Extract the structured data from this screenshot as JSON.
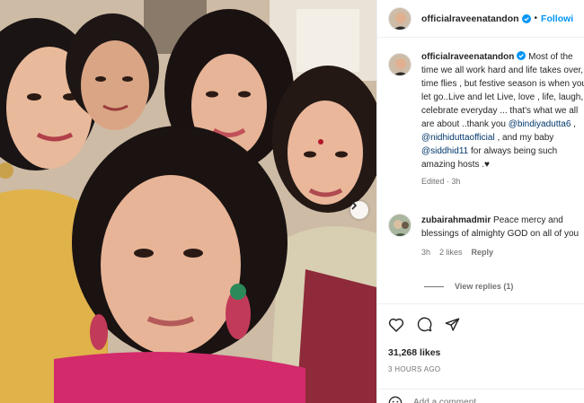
{
  "post": {
    "username": "officialraveenatandon",
    "follow_label": "Followi",
    "separator": "•"
  },
  "caption": {
    "username": "officialraveenatandon",
    "text_1": " Most of the time we all work hard and life takes over, time flies , but festive season is when you let go..Live and let Live, love , life, laugh, celebrate everyday ... that's what we all are about ..thank you ",
    "mention_1": "@bindiyadutta6",
    "text_2": " , ",
    "mention_2": "@nidhiduttaofficial",
    "text_3": " , and my baby ",
    "mention_3": "@siddhid11",
    "text_4": " for always being such amazing hosts .",
    "heart": "♥",
    "meta": "Edited · 3h"
  },
  "comment": {
    "username": "zubairahmadmir",
    "text": " Peace mercy and blessings of almighty GOD on all of you",
    "time": "3h",
    "likes": "2 likes",
    "reply_label": "Reply"
  },
  "view_replies": "View replies (1)",
  "likes_count": "31,268 likes",
  "timestamp": "3 HOURS AGO",
  "add_comment_placeholder": "Add a comment...",
  "colors": {
    "accent": "#0095f6",
    "verified": "#0095f6",
    "mention": "#00376b",
    "muted": "#737373"
  }
}
